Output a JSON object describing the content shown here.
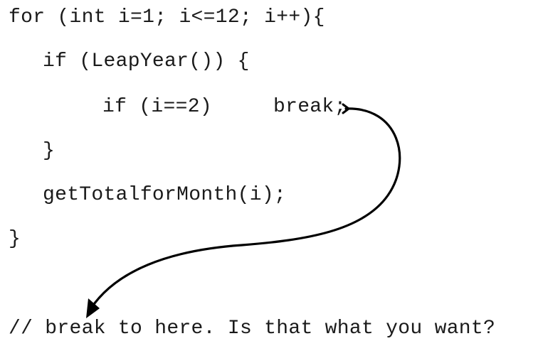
{
  "code": {
    "line_1": "for (int i=1; i<=12; i++){",
    "line_2": "if (LeapYear()) {",
    "line_3": "if (i==2)",
    "line_3_keyword": "break;",
    "line_4": "}",
    "line_5": "getTotalforMonth(i);",
    "line_6": "}",
    "comment": "// break to here. Is that what you want?"
  },
  "colors": {
    "text": "#1a1a1a",
    "arrow": "#000000",
    "background": "#ffffff"
  }
}
